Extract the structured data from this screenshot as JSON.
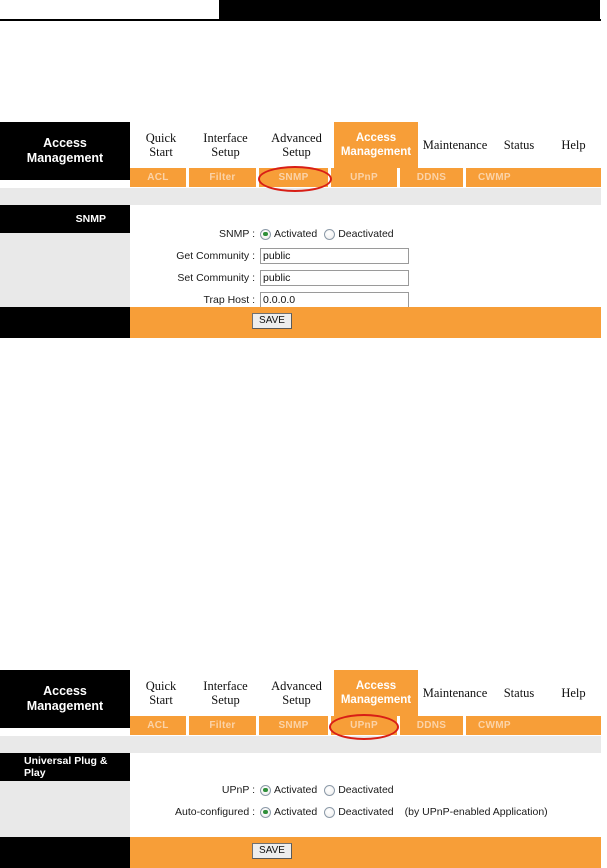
{
  "page": {
    "brand_line1": "Access",
    "brand_line2": "Management"
  },
  "main_tabs": [
    {
      "line1": "Quick",
      "line2": "Start"
    },
    {
      "line1": "Interface",
      "line2": "Setup"
    },
    {
      "line1": "Advanced",
      "line2": "Setup"
    },
    {
      "line1": "Access",
      "line2": "Management"
    },
    {
      "line1": "Maintenance",
      "line2": ""
    },
    {
      "line1": "Status",
      "line2": ""
    },
    {
      "line1": "Help",
      "line2": ""
    }
  ],
  "sub_tabs": [
    {
      "label": "ACL"
    },
    {
      "label": "Filter"
    },
    {
      "label": "SNMP"
    },
    {
      "label": "UPnP"
    },
    {
      "label": "DDNS"
    },
    {
      "label": "CWMP"
    }
  ],
  "snmp_section": {
    "panel_title": "SNMP",
    "fields": {
      "snmp_label": "SNMP :",
      "snmp_activated": "Activated",
      "snmp_deactivated": "Deactivated",
      "get_community_label": "Get Community :",
      "get_community_value": "public",
      "set_community_label": "Set Community :",
      "set_community_value": "public",
      "trap_host_label": "Trap Host :",
      "trap_host_value": "0.0.0.0"
    },
    "save_label": "SAVE",
    "highlighted_tab": "SNMP"
  },
  "upnp_section": {
    "panel_title": "Universal Plug & Play",
    "fields": {
      "upnp_label": "UPnP :",
      "upnp_activated": "Activated",
      "upnp_deactivated": "Deactivated",
      "auto_label": "Auto-configured :",
      "auto_activated": "Activated",
      "auto_deactivated": "Deactivated",
      "auto_note": "(by UPnP-enabled Application)"
    },
    "save_label": "SAVE",
    "highlighted_tab": "UPnP"
  },
  "colors": {
    "accent_orange": "#F79E38",
    "sub_tab_text": "#FBD3A8",
    "panel_black": "#000000",
    "gray": "#E9E9E9",
    "highlight_red": "#D81E16",
    "radio_green": "#2F8F3A"
  }
}
